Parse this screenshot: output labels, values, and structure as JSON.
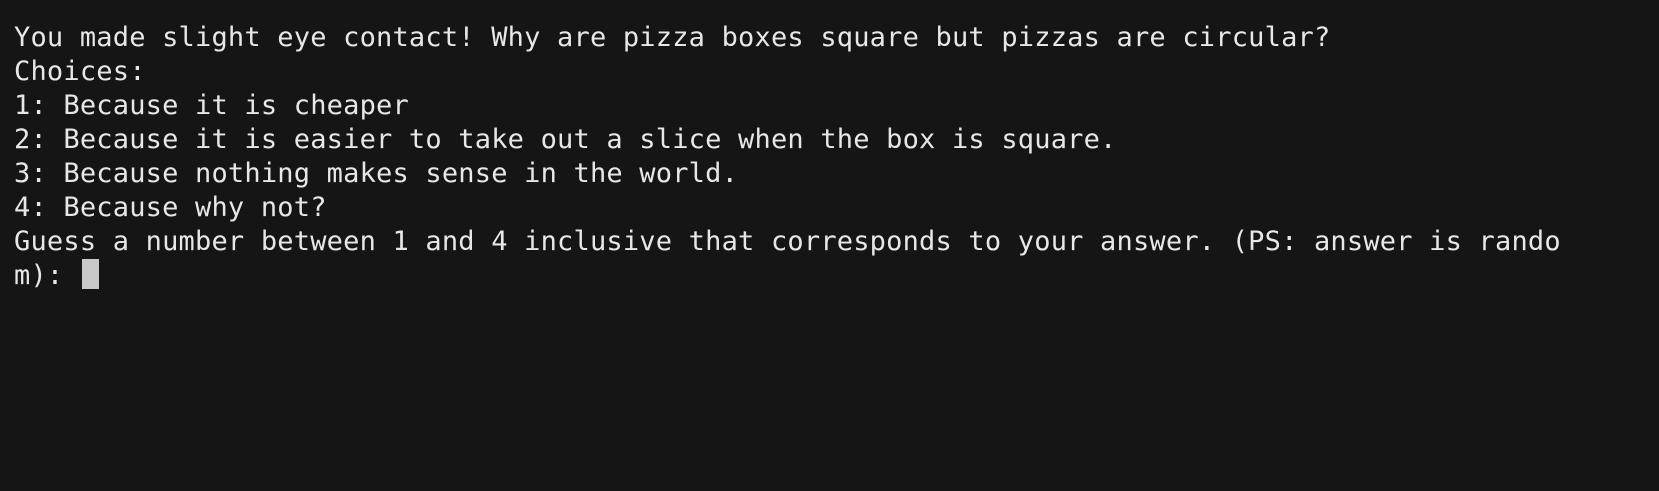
{
  "terminal": {
    "clipped_top_line": "",
    "lines": [
      "You made slight eye contact! Why are pizza boxes square but pizzas are circular?",
      "Choices:",
      "1: Because it is cheaper",
      "2: Because it is easier to take out a slice when the box is square.",
      "3: Because nothing makes sense in the world.",
      "4: Because why not?",
      "Guess a number between 1 and 4 inclusive that corresponds to your answer. (PS: answer is rando"
    ],
    "prompt_tail": "m): ",
    "colors": {
      "background": "#151515",
      "text": "#e7e7e7",
      "cursor": "#c8c8c8"
    }
  }
}
